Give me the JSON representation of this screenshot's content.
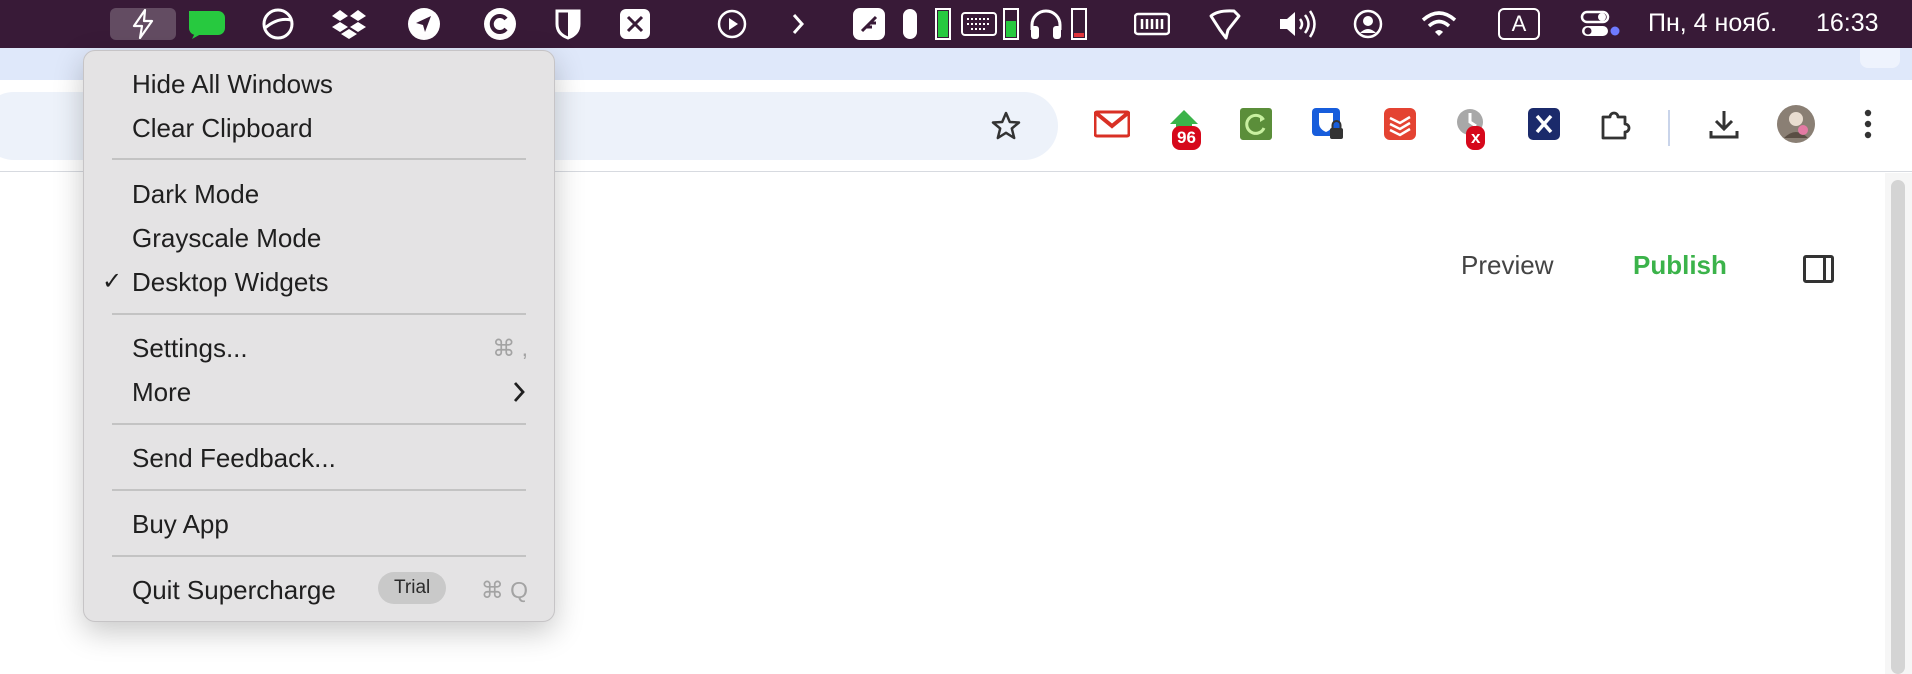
{
  "menubar": {
    "date": "Пн, 4 нояб.",
    "time": "16:33",
    "input_source": "A",
    "icons": [
      "supercharge-icon",
      "messages-icon",
      "globe-icon",
      "dropbox-icon",
      "send-icon",
      "c-logo-icon",
      "shield-icon",
      "x-box-icon",
      "play-circle-icon",
      "chevron-right-icon",
      "feather-icon",
      "mic-level-icon",
      "battery-green-icon",
      "keyboard-icon",
      "keyboard-battery-icon",
      "headphones-icon",
      "headphones-battery-icon",
      "memory-icon",
      "hand-icon",
      "volume-icon",
      "user-circle-icon",
      "wifi-icon",
      "input-source-icon",
      "control-center-icon"
    ]
  },
  "toolbar": {
    "extensions": [
      {
        "name": "gmail-icon",
        "badge": ""
      },
      {
        "name": "updates-icon",
        "badge": "96"
      },
      {
        "name": "refresh-extension-icon",
        "badge": ""
      },
      {
        "name": "bitwarden-icon",
        "badge": ""
      },
      {
        "name": "todoist-icon",
        "badge": ""
      },
      {
        "name": "timer-extension-icon",
        "badge": "x"
      },
      {
        "name": "x-extension-icon",
        "badge": ""
      },
      {
        "name": "puzzle-icon",
        "badge": ""
      }
    ]
  },
  "page": {
    "preview_label": "Preview",
    "publish_label": "Publish",
    "publish_color": "#3bb34a"
  },
  "menu": {
    "hide_all_windows": "Hide All Windows",
    "clear_clipboard": "Clear Clipboard",
    "dark_mode": "Dark Mode",
    "grayscale_mode": "Grayscale Mode",
    "desktop_widgets": "Desktop Widgets",
    "desktop_widgets_checked": true,
    "checkmark": "✓",
    "settings": "Settings...",
    "settings_shortcut": "⌘ ,",
    "more": "More",
    "send_feedback": "Send Feedback...",
    "buy_app": "Buy App",
    "quit": "Quit Supercharge",
    "trial_badge": "Trial",
    "quit_shortcut": "⌘ Q"
  }
}
